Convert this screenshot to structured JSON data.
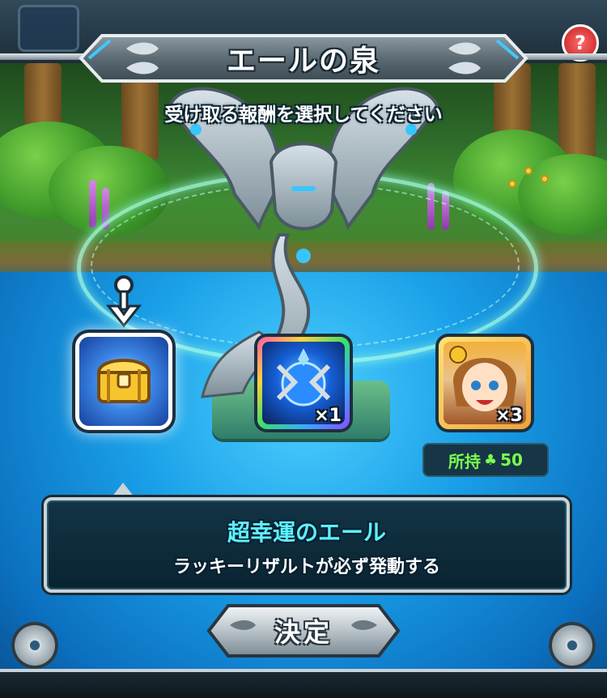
{
  "header": {
    "title": "エールの泉",
    "subtitle": "受け取る報酬を選択してください",
    "help_symbol": "?"
  },
  "rewards": [
    {
      "id": "chest",
      "icon": "treasure-chest-icon",
      "quantity": "",
      "selected": true
    },
    {
      "id": "orb",
      "icon": "dark-orb-icon",
      "quantity": "×1",
      "selected": false
    },
    {
      "id": "character",
      "icon": "character-portrait-icon",
      "quantity": "×3",
      "selected": false
    }
  ],
  "owned": {
    "label": "所持",
    "icon": "clover-icon",
    "count": "50"
  },
  "info": {
    "name": "超幸運のエール",
    "description": "ラッキーリザルトが必ず発動する"
  },
  "confirm": {
    "label": "決定"
  },
  "colors": {
    "info_name": "#5ef0ff",
    "owned_text": "#7bff4e"
  }
}
